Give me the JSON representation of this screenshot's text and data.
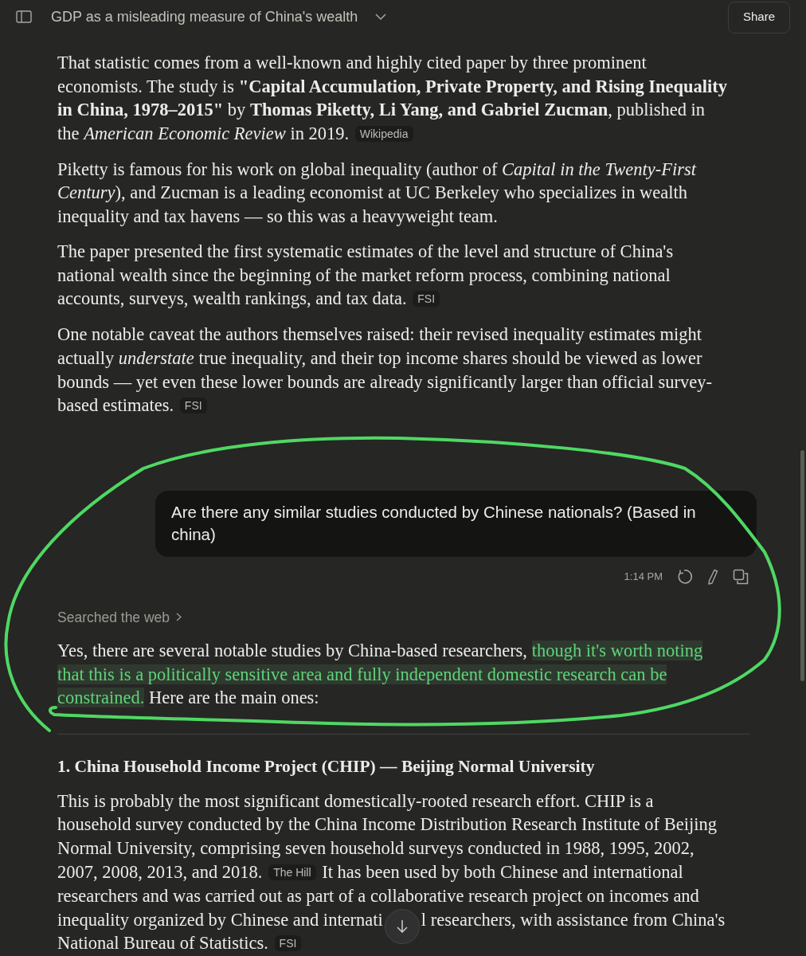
{
  "header": {
    "title": "GDP as a misleading measure of China's wealth",
    "share_label": "Share"
  },
  "earlier_reply": [
    {
      "segments": [
        {
          "kind": "text",
          "text": "That statistic comes from a well-known and highly cited paper by three prominent economists. The study is **\"Capital Accumulation, Private Property, and Rising Inequality in China, 1978–2015\"** by **Thomas Piketty, Li Yang, and Gabriel Zucman**, published in the *American Economic Review* in 2019."
        },
        {
          "kind": "cite",
          "text": "Wikipedia"
        }
      ]
    },
    {
      "segments": [
        {
          "kind": "text",
          "text": "Piketty is famous for his work on global inequality (author of *Capital in the Twenty-First Century*), and Zucman is a leading economist at UC Berkeley who specializes in wealth inequality and tax havens — so this was a heavyweight team."
        }
      ]
    },
    {
      "segments": [
        {
          "kind": "text",
          "text": "The paper presented the first systematic estimates of the level and structure of China's national wealth since the beginning of the market reform process, combining national accounts, surveys, wealth rankings, and tax data."
        },
        {
          "kind": "cite",
          "text": "FSI"
        }
      ]
    },
    {
      "segments": [
        {
          "kind": "text",
          "text": "One notable caveat the authors themselves raised: their revised inequality estimates might actually *understate* true inequality, and their top income shares should be viewed as lower bounds — yet even these lower bounds are already significantly larger than official survey-based estimates."
        },
        {
          "kind": "cite",
          "text": "FSI"
        }
      ]
    }
  ],
  "user_message": {
    "text": "Are there any similar studies conducted by Chinese nationals? (Based in china)",
    "time": "1:14 PM"
  },
  "searched_label": "Searched the web",
  "reply": [
    {
      "kind": "paragraph",
      "segments": [
        {
          "kind": "text",
          "text": "Yes, there are several notable studies by China-based researchers, "
        },
        {
          "kind": "highlight",
          "text": "though it's worth noting that this is a politically sensitive area and fully independent domestic research can be constrained."
        },
        {
          "kind": "text",
          "text": " Here are the main ones:"
        }
      ]
    },
    {
      "kind": "divider"
    },
    {
      "kind": "heading",
      "text": "1. China Household Income Project (CHIP) — Beijing Normal University"
    },
    {
      "kind": "paragraph",
      "segments": [
        {
          "kind": "text",
          "text": "This is probably the most significant domestically-rooted research effort. CHIP is a household survey conducted by the China Income Distribution Research Institute of Beijing Normal University, comprising seven household surveys conducted in 1988, 1995, 2002, 2007, 2008, 2013, and 2018."
        },
        {
          "kind": "cite",
          "text": "The Hill"
        },
        {
          "kind": "text",
          "text": "It has been used by both Chinese and international researchers and was carried out as part of a collaborative research project on incomes and inequality organized by Chinese and internati"
        },
        {
          "kind": "covered"
        },
        {
          "kind": "text",
          "text": "l researchers, with assistance from China's National Bureau of Statistics."
        },
        {
          "kind": "cite",
          "text": "FSI"
        }
      ]
    }
  ]
}
